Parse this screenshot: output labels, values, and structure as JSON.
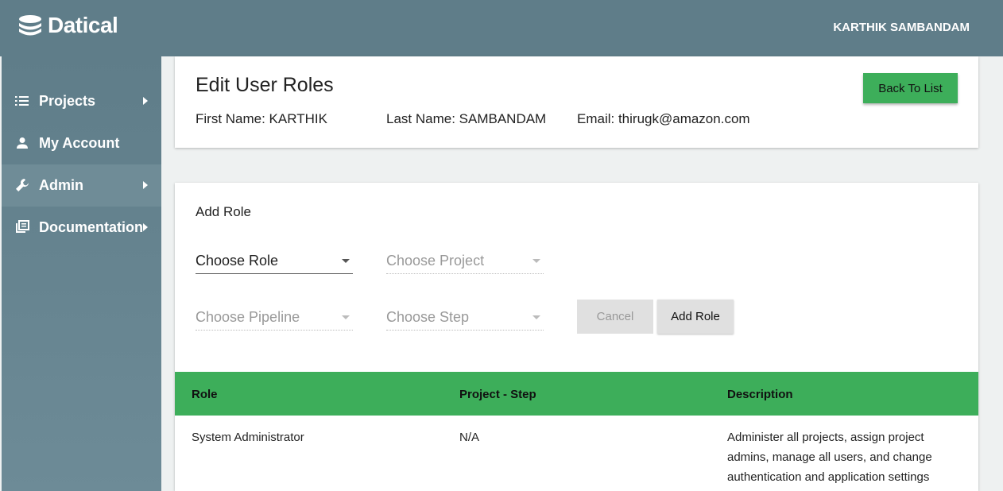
{
  "header": {
    "brand": "Datical",
    "user_name": "KARTHIK SAMBANDAM"
  },
  "sidebar": {
    "items": [
      {
        "label": "Projects",
        "icon": "list-icon",
        "has_submenu": true
      },
      {
        "label": "My Account",
        "icon": "person-icon",
        "has_submenu": false
      },
      {
        "label": "Admin",
        "icon": "wrench-icon",
        "has_submenu": true,
        "active": true
      },
      {
        "label": "Documentation",
        "icon": "library-books-icon",
        "has_submenu": true
      }
    ]
  },
  "user_card": {
    "title": "Edit User Roles",
    "first_name": "First Name: KARTHIK",
    "last_name": "Last Name: SAMBANDAM",
    "email": "Email: thirugk@amazon.com",
    "back_button": "Back To List"
  },
  "add_role": {
    "title": "Add Role",
    "role_select": "Choose Role",
    "project_select": "Choose Project",
    "pipeline_select": "Choose Pipeline",
    "step_select": "Choose Step",
    "cancel_button": "Cancel",
    "add_button": "Add Role"
  },
  "roles_table": {
    "columns": [
      "Role",
      "Project - Step",
      "Description"
    ],
    "rows": [
      {
        "role": "System Administrator",
        "project_step": "N/A",
        "description_lines": [
          "Administer all projects, assign project",
          "admins, manage all users, and change",
          "authentication and application settings"
        ]
      }
    ]
  },
  "colors": {
    "topbar": "#5f7d89",
    "accent_green": "#3dae5a",
    "background": "#eef1f1"
  }
}
